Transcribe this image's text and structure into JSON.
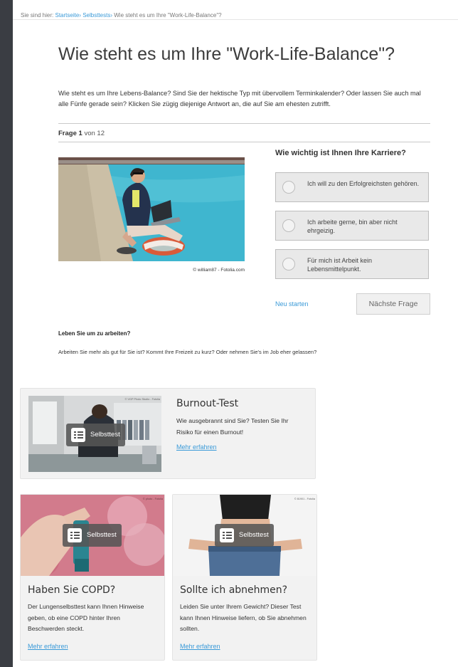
{
  "breadcrumb": {
    "prefix": "Sie sind hier:",
    "items": [
      "Startseite",
      "Selbsttests"
    ],
    "current": "Wie steht es um Ihre \"Work-Life-Balance\"?"
  },
  "page": {
    "title": "Wie steht es um Ihre \"Work-Life-Balance\"?",
    "intro": "Wie steht es um Ihre Lebens-Balance? Sind Sie der hektische Typ mit übervollem Terminkalender? Oder lassen Sie auch mal alle Fünfe gerade sein? Klicken Sie zügig diejenige Antwort an, die auf Sie am ehesten zutrifft."
  },
  "quiz": {
    "frage_label": "Frage",
    "current": "1",
    "of_label": "von 12",
    "image_credit": "© william87 - Fotolia.com",
    "question": "Wie wichtig ist Ihnen Ihre Karriere?",
    "answers": [
      "Ich will zu den Erfolgreichsten gehören.",
      "Ich arbeite gerne, bin aber nicht ehrgeizig.",
      "Für mich ist Arbeit kein Lebensmittelpunkt."
    ],
    "restart_label": "Neu starten",
    "next_label": "Nächste Frage"
  },
  "info": {
    "heading": "Leben Sie um zu arbeiten?",
    "text": "Arbeiten Sie mehr als gut für Sie ist? Kommt Ihre Freizeit zu kurz? Oder nehmen Sie's im Job eher gelassen?"
  },
  "cards": {
    "badge_label": "Selbsttest",
    "more_label": "Mehr erfahren",
    "burnout": {
      "title": "Burnout-Test",
      "desc": "Wie ausgebrannt sind Sie? Testen Sie Ihr Risiko für einen Burnout!",
      "watermark": "© VGP Photo Studio - Fotolia"
    },
    "copd": {
      "title": "Haben Sie COPD?",
      "desc": "Der Lungenselbsttest kann Ihnen Hinweise geben, ob eine COPD hinter Ihren Beschwerden steckt.",
      "watermark": "© photo - Fotolia"
    },
    "abnehmen": {
      "title": "Sollte ich abnehmen?",
      "desc": "Leiden Sie unter Ihrem Gewicht? Dieser Test kann Ihnen Hinweise liefern, ob Sie abnehmen sollten.",
      "watermark": "© 81901 - Fotolia"
    }
  },
  "colors": {
    "link": "#3a9ad8",
    "sidebar": "#3a3d43",
    "card_bg": "#f2f2f2",
    "answer_bg": "#e9e9e9"
  }
}
